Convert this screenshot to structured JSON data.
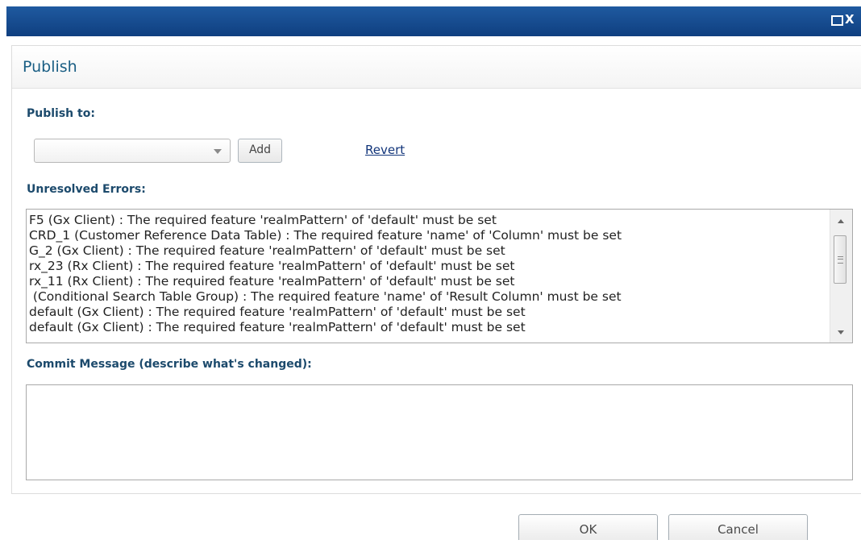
{
  "window": {
    "maximize_icon": "maximize-icon",
    "close_label": "X"
  },
  "dialog": {
    "title": "Publish"
  },
  "publish_to": {
    "label": "Publish to:",
    "combo_value": "",
    "add_label": "Add",
    "revert_label": "Revert"
  },
  "errors": {
    "label": "Unresolved Errors:",
    "lines": [
      "F5 (Gx Client) : The required feature 'realmPattern' of 'default' must be set",
      "CRD_1 (Customer Reference Data Table) : The required feature 'name' of 'Column' must be set",
      "G_2 (Gx Client) : The required feature 'realmPattern' of 'default' must be set",
      "rx_23 (Rx Client) : The required feature 'realmPattern' of 'default' must be set",
      "rx_11 (Rx Client) : The required feature 'realmPattern' of 'default' must be set",
      " (Conditional Search Table Group) : The required feature 'name' of 'Result Column' must be set",
      "default (Gx Client) : The required feature 'realmPattern' of 'default' must be set",
      "default (Gx Client) : The required feature 'realmPattern' of 'default' must be set"
    ]
  },
  "commit": {
    "label": "Commit Message (describe what's changed):",
    "value": ""
  },
  "buttons": {
    "ok": "OK",
    "cancel": "Cancel"
  }
}
